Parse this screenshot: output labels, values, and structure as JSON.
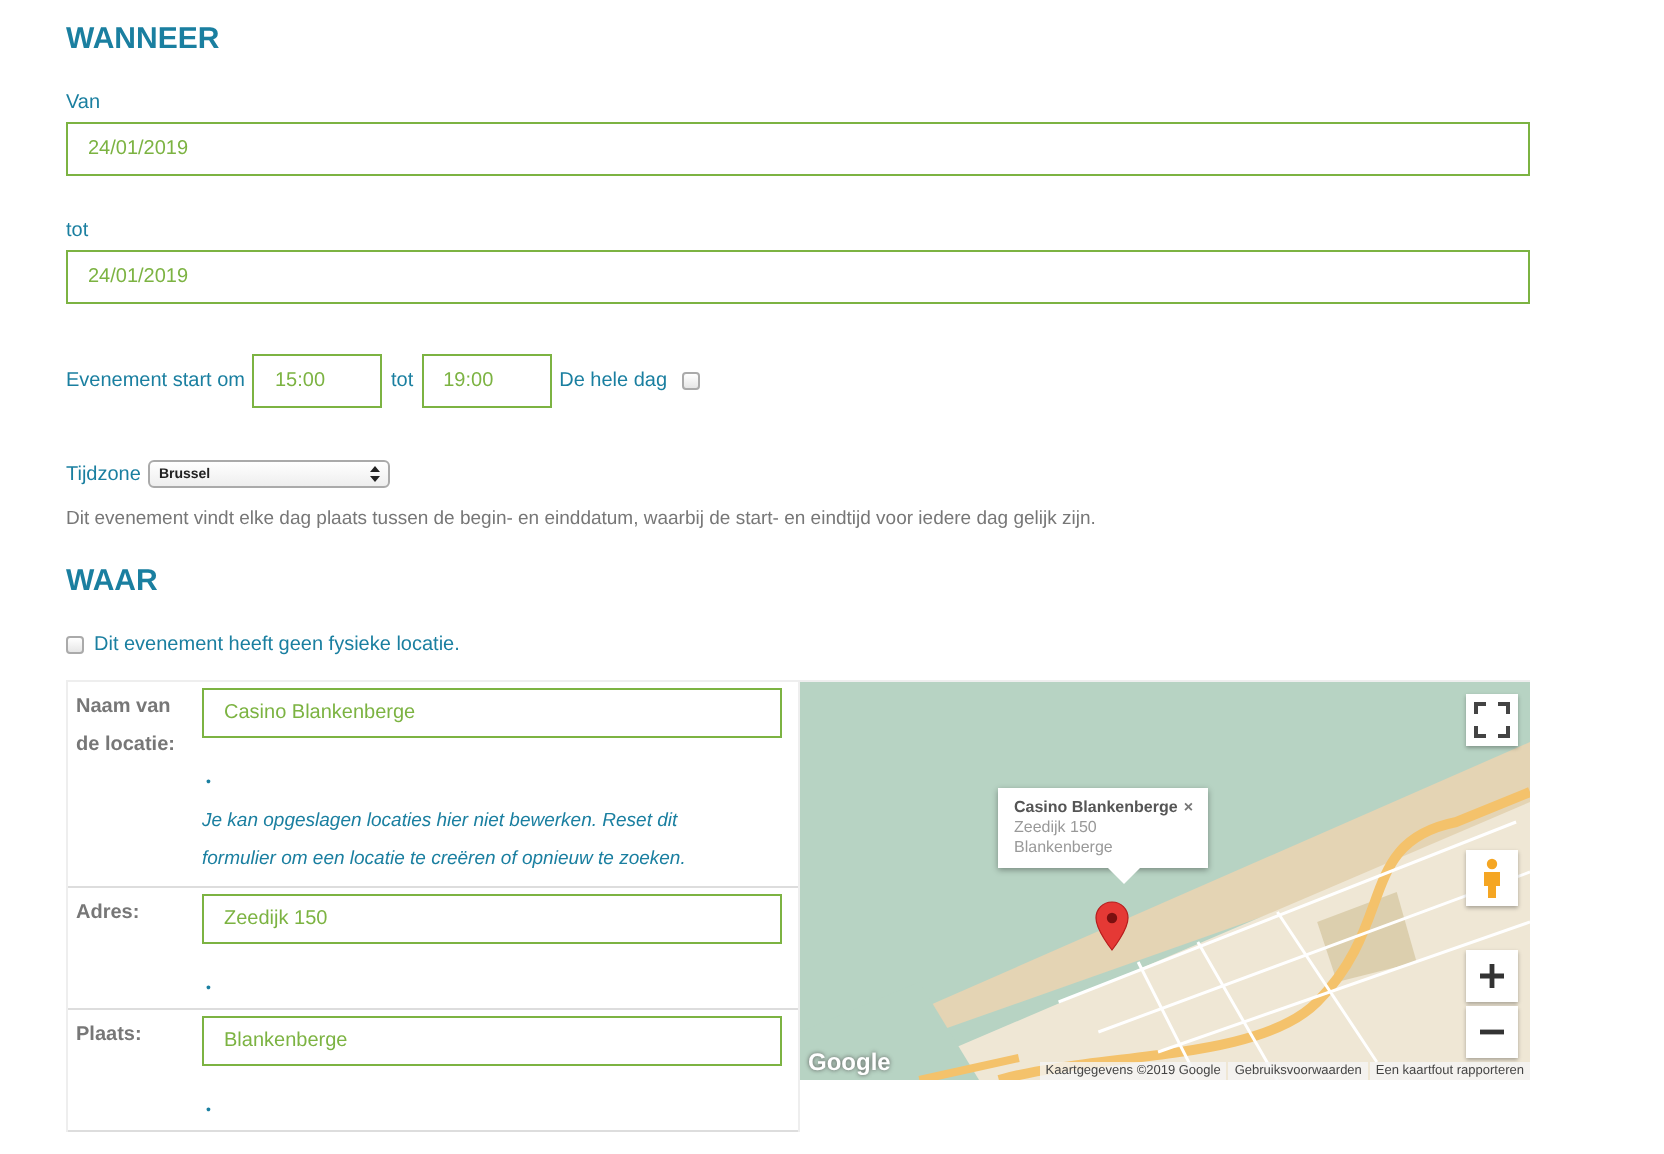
{
  "wanneer": {
    "heading": "WANNEER",
    "from": {
      "label": "Van",
      "value": "24/01/2019"
    },
    "to": {
      "label": "tot",
      "value": "24/01/2019"
    },
    "time": {
      "label": "Evenement start om",
      "start": "15:00",
      "separator": "tot",
      "end": "19:00",
      "all_day_label": "De hele dag",
      "all_day_checked": false
    },
    "timezone": {
      "label": "Tijdzone",
      "value": "Brussel"
    },
    "note": "Dit evenement vindt elke dag plaats tussen de begin- en einddatum, waarbij de start- en eindtijd voor iedere dag gelijk zijn."
  },
  "waar": {
    "heading": "WAAR",
    "no_location": {
      "label": "Dit evenement heeft geen fysieke locatie.",
      "checked": false
    },
    "rows": [
      {
        "label": "Naam van de locatie:",
        "value": "Casino Blankenberge",
        "marker": "•",
        "help": "Je kan opgeslagen locaties hier niet bewerken. Reset dit formulier om een locatie te creëren of opnieuw te zoeken."
      },
      {
        "label": "Adres:",
        "value": "Zeedijk 150",
        "marker": "•"
      },
      {
        "label": "Plaats:",
        "value": "Blankenberge",
        "marker": "•"
      }
    ],
    "map": {
      "kind": "picture",
      "info_window": {
        "title": "Casino Blankenberge",
        "close": "×",
        "lines": [
          "Zeedijk 150",
          "Blankenberge"
        ]
      },
      "logo": "Google",
      "attribution": [
        "Kaartgegevens ©2019 Google",
        "Gebruiksvoorwaarden",
        "Een kaartfout rapporteren"
      ]
    }
  }
}
